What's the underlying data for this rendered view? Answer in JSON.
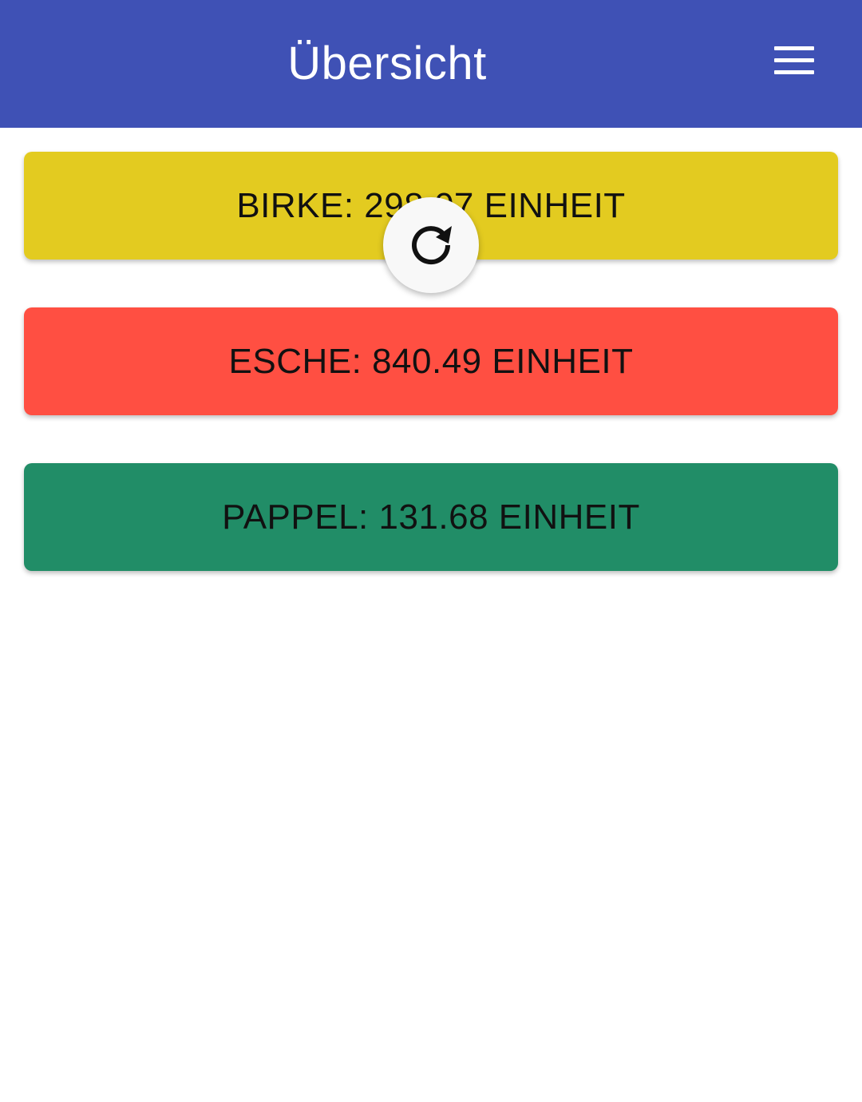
{
  "header": {
    "title": "Übersicht",
    "menu_icon": "hamburger-menu-icon",
    "background_color": "#3f51b5"
  },
  "cards": [
    {
      "id": "birke",
      "label": "BIRKE: 298.07 EINHEIT",
      "color": "#e3cb20"
    },
    {
      "id": "esche",
      "label": "ESCHE: 840.49 EINHEIT",
      "color": "#ff4f42"
    },
    {
      "id": "pappel",
      "label": "PAPPEL: 131.68 EINHEIT",
      "color": "#218d67"
    }
  ],
  "refresh_indicator": {
    "icon": "refresh-icon"
  }
}
